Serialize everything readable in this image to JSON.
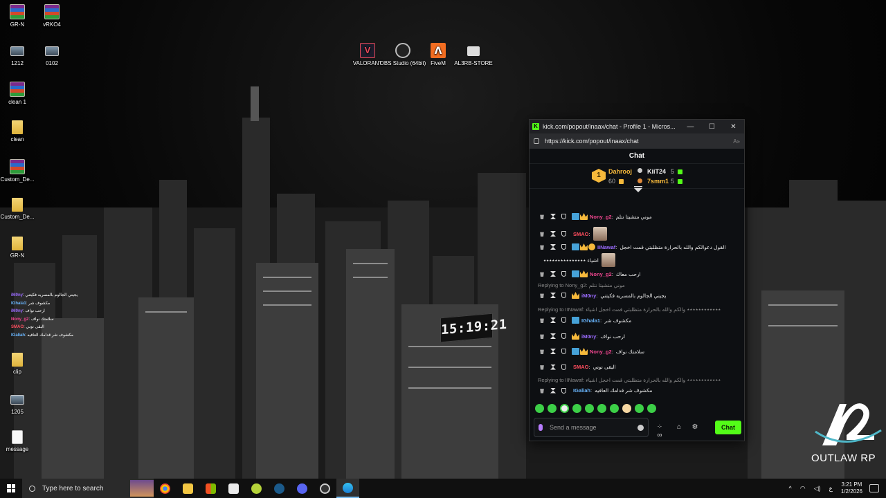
{
  "desktop": {
    "icons": [
      {
        "label": "GR-N",
        "icon": "winrar-icon"
      },
      {
        "label": "vRKO4",
        "icon": "winrar-icon"
      },
      {
        "label": "1212",
        "icon": "image-icon"
      },
      {
        "label": "0102",
        "icon": "image-icon"
      },
      {
        "label": "clean 1",
        "icon": "winrar-icon"
      },
      {
        "label": "clean",
        "icon": "folder-icon"
      },
      {
        "label": "Custom_De...",
        "icon": "winrar-icon"
      },
      {
        "label": "Custom_De...",
        "icon": "folder-icon"
      },
      {
        "label": "GR-N",
        "icon": "folder-icon"
      },
      {
        "label": "clip",
        "icon": "folder-icon"
      },
      {
        "label": "1205",
        "icon": "image-icon"
      },
      {
        "label": "message",
        "icon": "document-icon"
      },
      {
        "label": "VALORANT",
        "icon": "valorant-icon"
      },
      {
        "label": "OBS Studio (64bit)",
        "icon": "obs-icon"
      },
      {
        "label": "FiveM",
        "icon": "fivem-icon"
      },
      {
        "label": "AL3RB-STORE",
        "icon": "store-icon"
      }
    ],
    "wallpaper_clock": "15:19:21",
    "brand_logo_text": "OUTLAW RP"
  },
  "browser": {
    "title": "kick.com/popout/inaax/chat - Profile 1 - Micros...",
    "url": "https://kick.com/popout/inaax/chat",
    "controls": {
      "minimize": "—",
      "maximize": "☐",
      "close": "✕"
    }
  },
  "chat": {
    "header": "Chat",
    "leaderboard": {
      "rank_badge": "1",
      "top": {
        "name": "Dahrooj",
        "count": "60"
      },
      "second": {
        "name": "KiiT24",
        "count": "5"
      },
      "third": {
        "name": "7smm1",
        "count": "5"
      }
    },
    "messages": [
      {
        "user": "Nony_g2",
        "text": "موني متشيتا نتلم",
        "color": "#f0468f"
      },
      {
        "user": "SMAO",
        "text": "",
        "color": "#ff4d5e"
      },
      {
        "user": "IINawaf",
        "text": "القول دعوالكم والله بالحرارة متظلبتي قمت اخجل",
        "text2": "اشياء ٭٭٭٭٭٭٭٭٭٭٭٭٭٭٭",
        "color": "#9b6cff"
      },
      {
        "user": "Nony_g2",
        "text": "ارحب معاك",
        "color": "#f0468f"
      },
      {
        "reply": "Replying to Nony_g2: موني متشيتا نتلم"
      },
      {
        "user": "iM0ny",
        "text": "يجيني الجالوم بالمسريه فكيتني",
        "color": "#9b6cff"
      },
      {
        "reply": "Replying to IINawaf: ٭٭٭٭٭٭٭٭٭٭٭٭ والكم والله بالحرارة متظلبتي قمت اخجل اشياء"
      },
      {
        "user": "IGhala1",
        "text": "مكشوف شر",
        "color": "#6ab7ff"
      },
      {
        "user": "iM0ny",
        "text": "ارحب نواف",
        "color": "#9b6cff"
      },
      {
        "user": "Nony_g2",
        "text": "سلامتك نواف",
        "color": "#f0468f"
      },
      {
        "user": "SMAO",
        "text": "البقى نوني",
        "color": "#ff4d5e"
      },
      {
        "reply": "Replying to IINawaf: ٭٭٭٭٭٭٭٭٭٭٭٭ والكم والله بالحرارة متظلبتي قمت اخجل اشياء"
      },
      {
        "user": "IGaliah",
        "text": "مكشوف شر قدامك العافيه",
        "color": "#6ab7ff"
      }
    ],
    "input_placeholder": "Send a message",
    "send_label": "Chat"
  },
  "mini_overlay": [
    {
      "user": "iM0ny",
      "text": ": يجيني الجالوم بالمسريه فكيتني"
    },
    {
      "user": "IGhala1",
      "text": ": مكشوف شر"
    },
    {
      "user": "iM0ny",
      "text": ": ارحب نواف"
    },
    {
      "user": "Nony_g2",
      "text": ": سلامتك نواف"
    },
    {
      "user": "SMAO",
      "text": ": البقى نوني"
    },
    {
      "user": "IGaliah",
      "text": ": مكشوف شر قدامك العافيه"
    }
  ],
  "taskbar": {
    "search_placeholder": "Type here to search",
    "apps": [
      "chrome-icon",
      "file-explorer-icon",
      "store-icon",
      "mail-icon",
      "tennis-ball-icon",
      "steam-icon",
      "discord-icon",
      "obs-icon",
      "edge-icon"
    ],
    "tray": {
      "chevron": "^",
      "lang": "ع",
      "time": "3:21 PM",
      "date": "1/2/2026"
    }
  },
  "colors": {
    "kick_green": "#53fc18",
    "leader_gold": "#f6b93b",
    "window_bg": "#0d0f12"
  }
}
